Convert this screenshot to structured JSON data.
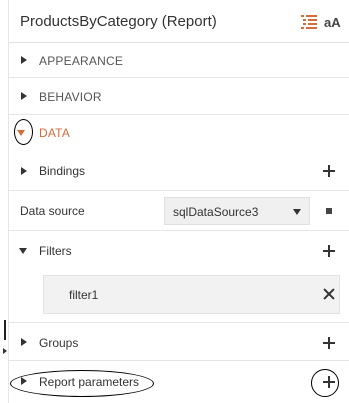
{
  "header": {
    "title": "ProductsByCategory (Report)",
    "sort_icon": "properties-list-icon",
    "sort_icon_color": "#d56c3a",
    "text_icon_label": "aA"
  },
  "sections": {
    "appearance": "APPEARANCE",
    "behavior": "BEHAVIOR",
    "data": "DATA"
  },
  "data": {
    "bindings_label": "Bindings",
    "data_source_label": "Data source",
    "data_source_value": "sqlDataSource3",
    "filters_label": "Filters",
    "filter_items": [
      "filter1"
    ],
    "groups_label": "Groups",
    "report_parameters_label": "Report parameters"
  },
  "colors": {
    "accent": "#d56c3a",
    "text": "#333333",
    "muted": "#555555"
  }
}
